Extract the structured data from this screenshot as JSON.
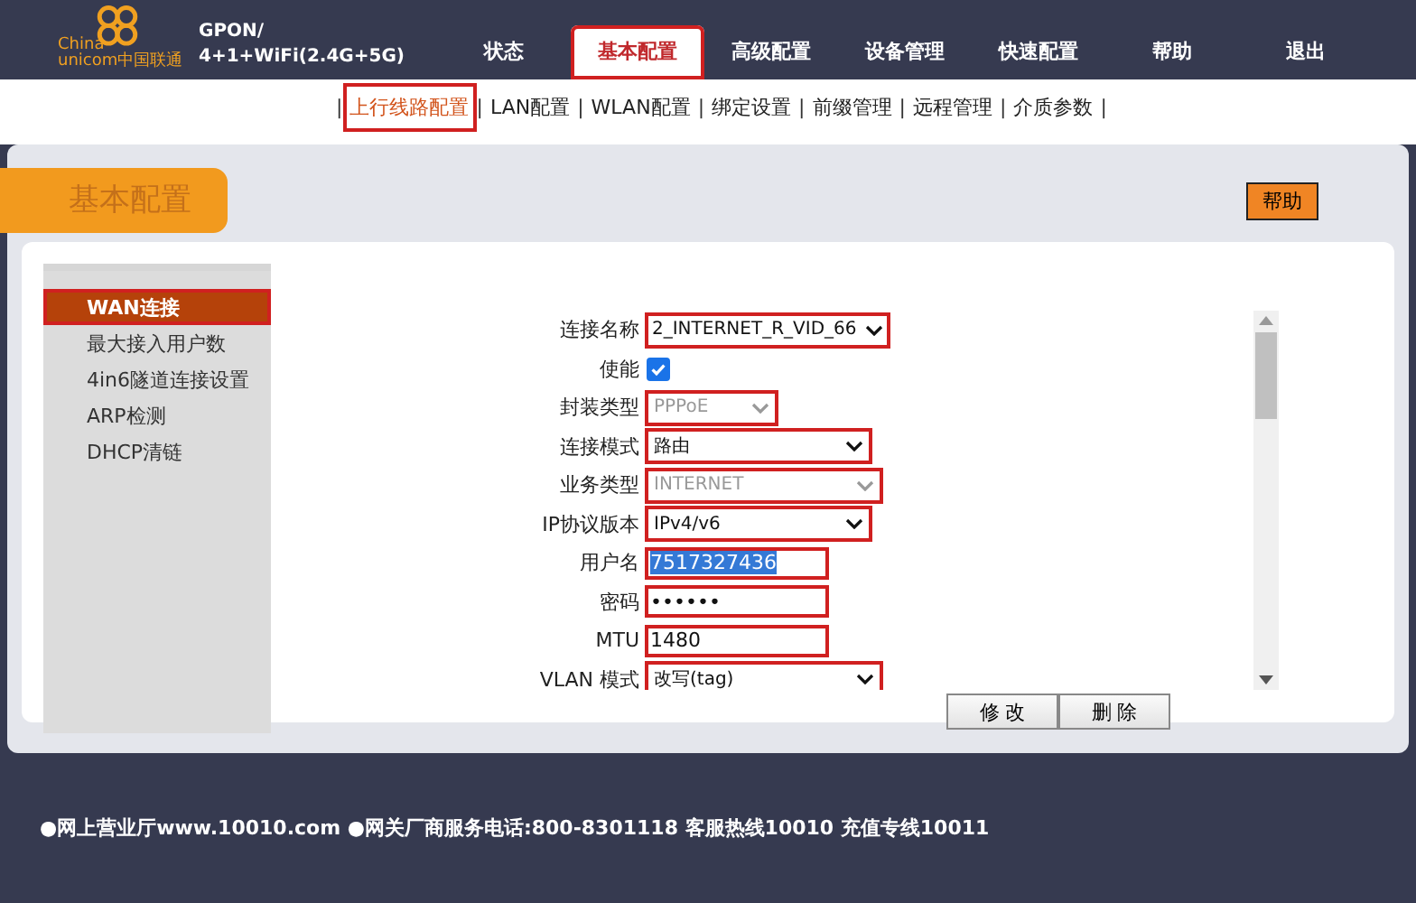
{
  "header": {
    "logo_text": [
      "China",
      "unicom中国联通"
    ],
    "product": [
      "GPON/",
      "4+1+WiFi(2.4G+5G)"
    ]
  },
  "nav": [
    {
      "label": "状态",
      "selected": false,
      "highlighted": false
    },
    {
      "label": "基本配置",
      "selected": true,
      "highlighted": true
    },
    {
      "label": "高级配置",
      "selected": false,
      "highlighted": false
    },
    {
      "label": "设备管理",
      "selected": false,
      "highlighted": false
    },
    {
      "label": "快速配置",
      "selected": false,
      "highlighted": false
    },
    {
      "label": "帮助",
      "selected": false,
      "highlighted": false
    },
    {
      "label": "退出",
      "selected": false,
      "highlighted": false
    }
  ],
  "subnav": [
    {
      "label": "上行线路配置",
      "selected": true,
      "highlighted": true
    },
    {
      "label": "LAN配置",
      "selected": false,
      "highlighted": false
    },
    {
      "label": "WLAN配置",
      "selected": false,
      "highlighted": false
    },
    {
      "label": "绑定设置",
      "selected": false,
      "highlighted": false
    },
    {
      "label": "前缀管理",
      "selected": false,
      "highlighted": false
    },
    {
      "label": "远程管理",
      "selected": false,
      "highlighted": false
    },
    {
      "label": "介质参数",
      "selected": false,
      "highlighted": false
    }
  ],
  "subnav_separator": "|",
  "page_title": "基本配置",
  "help_button": "帮助",
  "sidebar": [
    {
      "label": "WAN连接",
      "selected": true,
      "highlighted": true
    },
    {
      "label": "最大接入用户数",
      "selected": false,
      "highlighted": false
    },
    {
      "label": "4in6隧道连接设置",
      "selected": false,
      "highlighted": false
    },
    {
      "label": "ARP检测",
      "selected": false,
      "highlighted": false
    },
    {
      "label": "DHCP清链",
      "selected": false,
      "highlighted": false
    }
  ],
  "form": [
    {
      "kind": "select",
      "label": "连接名称",
      "value": "2_INTERNET_R_VID_66",
      "disabled": false,
      "highlighted": true,
      "wide": false
    },
    {
      "kind": "checkbox",
      "label": "使能",
      "checked": true
    },
    {
      "kind": "select",
      "label": "封装类型",
      "value": "PPPoE",
      "disabled": true,
      "highlighted": true,
      "wide": false
    },
    {
      "kind": "select",
      "label": "连接模式",
      "value": "路由",
      "disabled": false,
      "highlighted": true,
      "wide": false
    },
    {
      "kind": "select",
      "label": "业务类型",
      "value": "INTERNET",
      "disabled": true,
      "highlighted": true,
      "wide": true
    },
    {
      "kind": "select",
      "label": "IP协议版本",
      "value": "IPv4/v6",
      "disabled": false,
      "highlighted": true,
      "wide": false
    },
    {
      "kind": "text",
      "label": "用户名",
      "value": "7517327436",
      "text_selected": true,
      "highlighted": true
    },
    {
      "kind": "password",
      "label": "密码",
      "value": "••••••",
      "text_selected": false,
      "highlighted": true
    },
    {
      "kind": "text",
      "label": "MTU",
      "value": "1480",
      "text_selected": false,
      "highlighted": true
    },
    {
      "kind": "select",
      "label": "VLAN 模式",
      "value": "改写(tag)",
      "disabled": false,
      "highlighted": true,
      "wide": true
    }
  ],
  "buttons": [
    "修 改",
    "删 除"
  ],
  "footer": "●网上营业厅www.10010.com ●网关厂商服务电话:800-8301118 客服热线10010 充值专线10011"
}
